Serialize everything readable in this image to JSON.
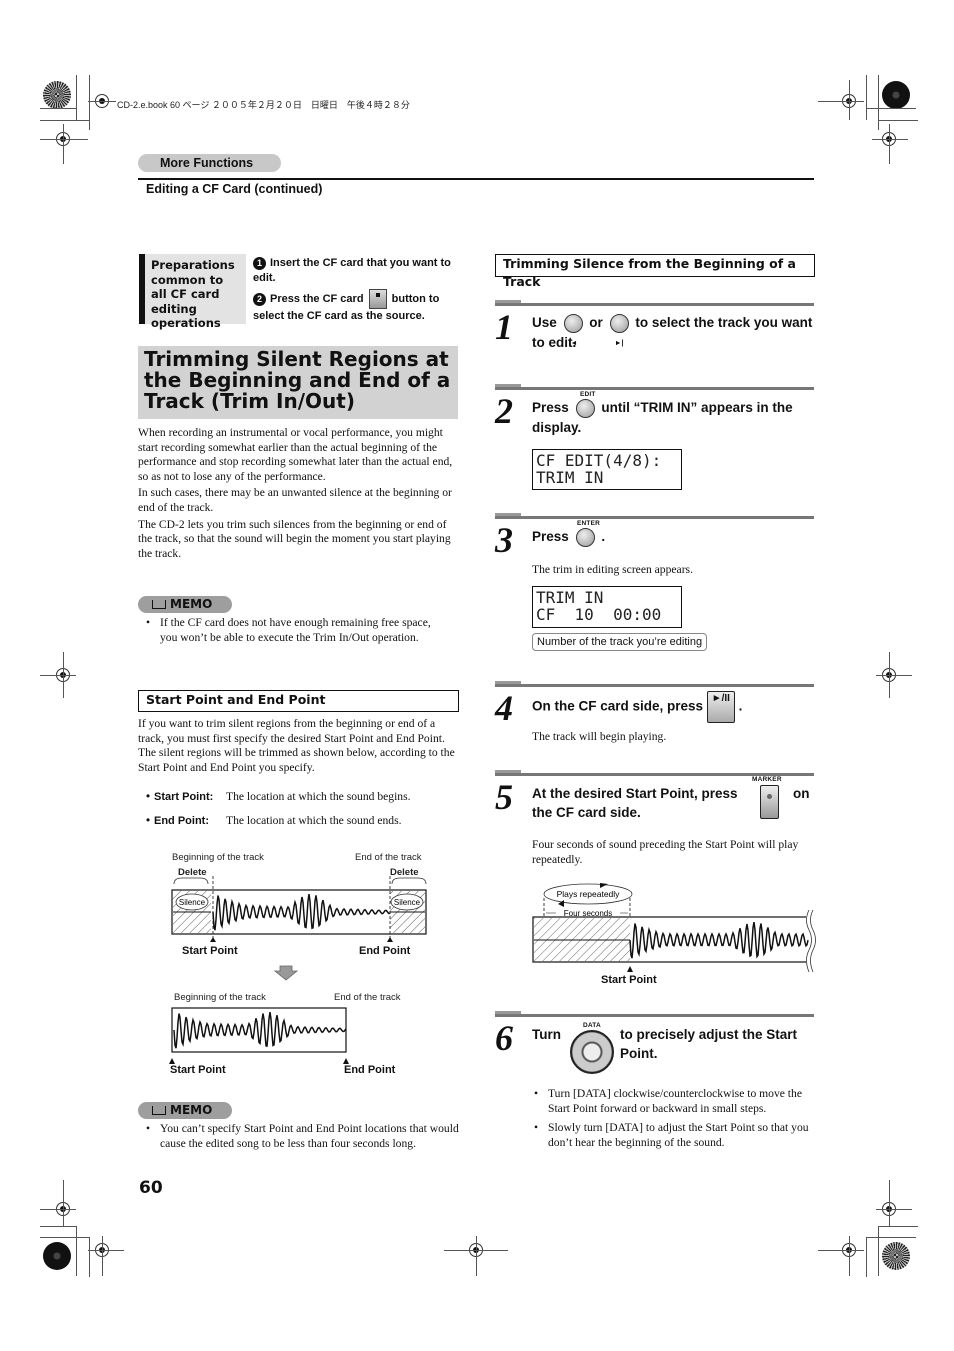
{
  "print_meta": "CD-2.e.book  60 ページ  ２００５年２月２０日　日曜日　午後４時２８分",
  "header": {
    "section": "More Functions",
    "subtitle": "Editing a CF Card (continued)"
  },
  "preparations": {
    "title": "Preparations common to all CF card editing operations",
    "steps": [
      {
        "num": "1",
        "text": "Insert the CF card that you want to edit."
      },
      {
        "num": "2",
        "text_before": "Press the CF card",
        "text_after": "button to select the CF card as the source."
      }
    ]
  },
  "left": {
    "heading": "Trimming Silent Regions at the Beginning and End of a Track (Trim In/Out)",
    "paragraphs": [
      "When recording an instrumental or vocal performance, you might start recording somewhat earlier than the actual beginning of the performance and stop recording somewhat later than the actual end, so as not to lose any of the performance.",
      "In such cases, there may be an unwanted silence at the beginning or end of the track.",
      "The CD-2 lets you trim such silences from the beginning or end of the track, so that the sound will begin the moment you start playing the track."
    ],
    "memo1": {
      "label": "MEMO",
      "items": [
        "If the CF card does not have enough remaining free space, you won’t be able to execute the Trim In/Out operation."
      ]
    },
    "subheading": "Start Point and End Point",
    "intro": "If you want to trim silent regions from the beginning or end of a track, you must first specify the desired Start Point and End Point. The silent regions will be trimmed as shown below, according to the Start Point and End Point you specify.",
    "definitions": [
      {
        "term": "Start Point:",
        "desc": "The location at which the sound begins."
      },
      {
        "term": "End Point:",
        "desc": "The location at which the sound ends."
      }
    ],
    "diagram": {
      "top": {
        "beginning": "Beginning of the track",
        "end": "End of the track",
        "delete_left": "Delete",
        "delete_right": "Delete",
        "silence_left": "Silence",
        "silence_right": "Silence",
        "start": "Start Point",
        "endpoint": "End Point"
      },
      "bottom": {
        "beginning": "Beginning of the track",
        "end": "End of the track",
        "start": "Start Point",
        "endpoint": "End Point"
      }
    },
    "memo2": {
      "label": "MEMO",
      "items": [
        "You can’t specify Start Point and End Point locations that would cause the edited song to be less than four seconds long."
      ]
    }
  },
  "right": {
    "heading": "Trimming Silence from the Beginning of a Track",
    "steps": [
      {
        "num": "1",
        "text_a": "Use",
        "text_b": "or",
        "text_c": "to select the track you want to edit."
      },
      {
        "num": "2",
        "text_a": "Press",
        "btn_caption": "EDIT",
        "text_c": "until “TRIM IN” appears in the display.",
        "lcd": [
          "CF EDIT(4/8):",
          "TRIM IN"
        ]
      },
      {
        "num": "3",
        "text_a": "Press",
        "btn_caption": "ENTER",
        "text_c": ".",
        "note": "The trim in editing screen appears.",
        "lcd": [
          "TRIM IN",
          "CF  10  00:00"
        ],
        "callout": "Number of the track you’re editing"
      },
      {
        "num": "4",
        "text_a": "On the CF card side, press",
        "btn_label": "►/II",
        "text_c": ".",
        "note": "The track will begin playing."
      },
      {
        "num": "5",
        "text_a": "At the desired Start Point, press",
        "btn_caption": "MARKER",
        "text_b": "on",
        "text_c": "the CF card side.",
        "note": "Four seconds of sound preceding the Start Point will play repeatedly.",
        "diagram": {
          "loop": "Plays repeatedly",
          "span": "Four seconds",
          "start": "Start Point"
        }
      },
      {
        "num": "6",
        "text_a": "Turn",
        "btn_caption": "DATA",
        "text_c": "to precisely adjust the Start Point.",
        "bullets": [
          "Turn [DATA] clockwise/counterclockwise to move the Start Point forward or backward in small steps.",
          "Slowly turn [DATA] to adjust the Start Point so that you don’t hear the beginning of the sound."
        ]
      }
    ]
  },
  "page_number": "60"
}
